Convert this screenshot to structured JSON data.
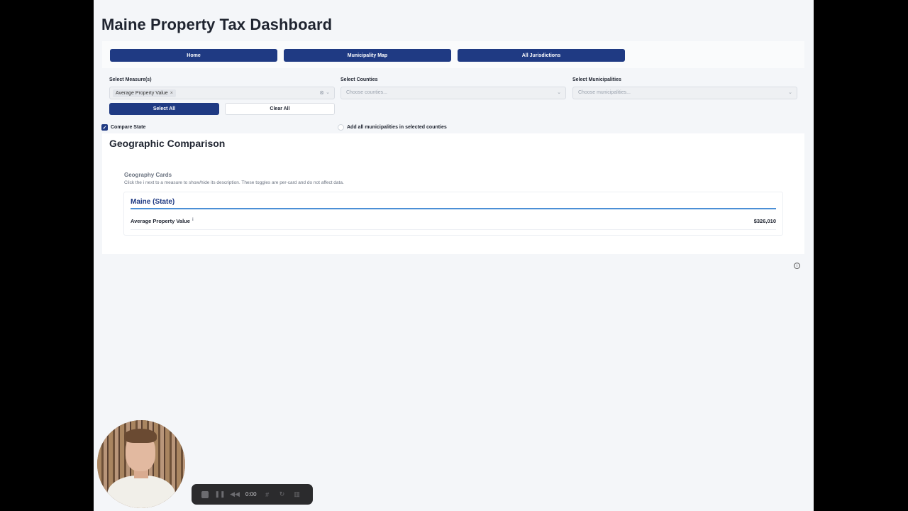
{
  "page": {
    "title": "Maine Property Tax Dashboard"
  },
  "nav": {
    "buttons": [
      "Home",
      "Municipality Map",
      "All Jurisdictions"
    ]
  },
  "filters": {
    "measures": {
      "label": "Select Measure(s)",
      "selected": "Average Property Value",
      "remove": "×",
      "clear": "⊗",
      "chevron": "⌄"
    },
    "counties": {
      "label": "Select Counties",
      "placeholder": "Choose counties...",
      "chevron": "⌄"
    },
    "municipalities": {
      "label": "Select Municipalities",
      "placeholder": "Choose municipalities...",
      "chevron": "⌄"
    },
    "select_all": "Select All",
    "clear_all": "Clear All",
    "compare_state": {
      "label": "Compare State",
      "checked": true,
      "mark": "✓"
    },
    "add_all": {
      "label": "Add all municipalities in selected counties",
      "checked": false
    }
  },
  "comparison": {
    "title": "Geographic Comparison",
    "cards_title": "Geography Cards",
    "cards_desc": "Click the i next to a measure to show/hide its description. These toggles are per-card and do not affect data.",
    "card": {
      "title": "Maine (State)",
      "measure": "Average Property Value",
      "info": "i",
      "value": "$326,010"
    }
  },
  "footer_info": "i",
  "recorder": {
    "time": "0:00"
  },
  "colors": {
    "primary": "#1f3a83",
    "accent_line": "#4b8fd6",
    "page_bg": "#f4f6f9"
  }
}
